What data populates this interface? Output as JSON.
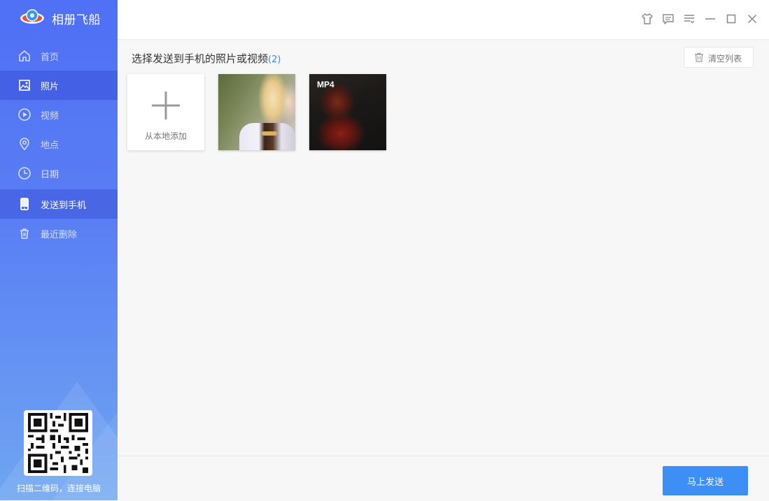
{
  "app": {
    "name": "相册飞船"
  },
  "sidebar": {
    "items": [
      {
        "label": "首页",
        "icon": "home-icon",
        "active": false
      },
      {
        "label": "照片",
        "icon": "photo-icon",
        "active": false
      },
      {
        "label": "视频",
        "icon": "play-icon",
        "active": false
      },
      {
        "label": "地点",
        "icon": "location-pin-icon",
        "active": false
      },
      {
        "label": "日期",
        "icon": "clock-icon",
        "active": false
      },
      {
        "label": "发送到手机",
        "icon": "phone-icon",
        "active": true
      },
      {
        "label": "最近删除",
        "icon": "trash-icon",
        "active": false
      }
    ],
    "qr_caption": "扫描二维码，连接电脑"
  },
  "titlebar": {
    "icons": [
      "shirt-icon",
      "message-icon",
      "menu-icon",
      "minimize-icon",
      "maximize-icon",
      "close-icon"
    ]
  },
  "main": {
    "title": "选择发送到手机的照片或视频",
    "count": "(2)",
    "clear_label": "清空列表",
    "add_label": "从本地添加",
    "items": [
      {
        "type": "photo",
        "badge": ""
      },
      {
        "type": "video",
        "badge": "MP4"
      }
    ]
  },
  "footer": {
    "send_label": "马上发送"
  },
  "colors": {
    "accent": "#3d8ef5",
    "sidebar_top": "#4f6ff5",
    "sidebar_bottom": "#6fa6f1"
  }
}
